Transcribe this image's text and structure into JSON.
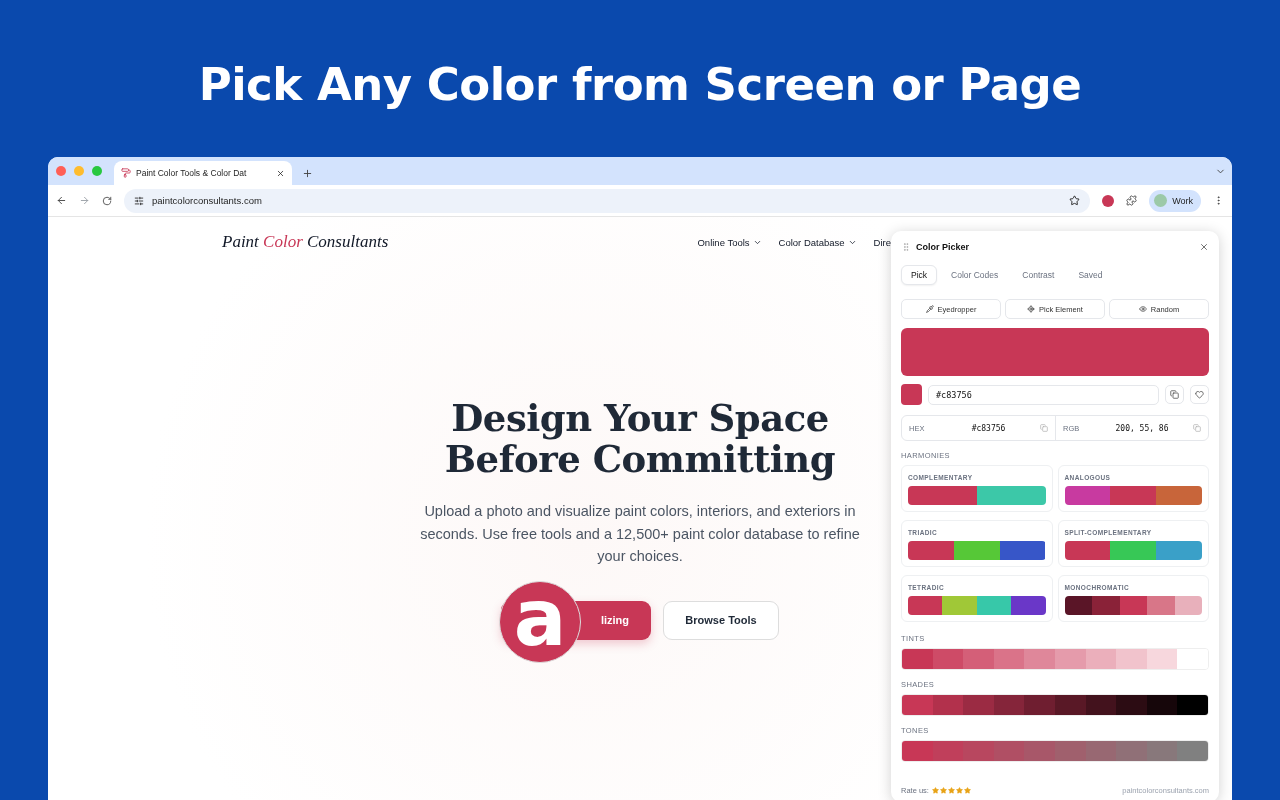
{
  "banner": {
    "title": "Pick Any Color from Screen or Page"
  },
  "browser": {
    "tab": {
      "title": "Paint Color Tools & Color Dat",
      "selected": true
    },
    "address": "paintcolorconsultants.com",
    "profile": "Work"
  },
  "site": {
    "logo": [
      "Paint ",
      "Color",
      " Consultants"
    ],
    "nav": [
      {
        "label": "Online Tools",
        "dropdown": true
      },
      {
        "label": "Color Database",
        "dropdown": true
      },
      {
        "label": "Dire",
        "dropdown": false
      }
    ],
    "hero": {
      "heading_lines": [
        "Design Your Space",
        "Before Committing"
      ],
      "text": "Upload a photo and visualize paint colors, interiors, and exteriors in seconds. Use free tools and a 12,500+ paint color database to refine your choices.",
      "primary_button": "lizing",
      "secondary_button": "Browse Tools",
      "magnifier_glyph": "a"
    }
  },
  "picker": {
    "title": "Color Picker",
    "tabs": [
      {
        "label": "Pick",
        "selected": true
      },
      {
        "label": "Color Codes",
        "selected": false
      },
      {
        "label": "Contrast",
        "selected": false
      },
      {
        "label": "Saved",
        "selected": false
      }
    ],
    "actions": [
      {
        "label": "Eyedropper",
        "kind": "eyedropper"
      },
      {
        "label": "Pick Element",
        "kind": "element"
      },
      {
        "label": "Random",
        "kind": "random"
      }
    ],
    "color": "#c83756",
    "value": "#c83756",
    "codes": [
      {
        "label": "HEX",
        "value": "#c83756"
      },
      {
        "label": "RGB",
        "value": "200, 55, 86"
      }
    ],
    "harmonies_label": "HARMONIES",
    "harmonies": [
      {
        "name": "COMPLEMENTARY",
        "chips": [
          {
            "color": "#c83756"
          },
          {
            "color": "#3cc8a8"
          }
        ]
      },
      {
        "name": "ANALOGOUS",
        "chips": [
          {
            "color": "#c83aa0"
          },
          {
            "color": "#c83756"
          },
          {
            "color": "#c8653a"
          }
        ]
      },
      {
        "name": "TRIADIC",
        "chips": [
          {
            "color": "#c83756"
          },
          {
            "color": "#56c837"
          },
          {
            "color": "#3756c8"
          }
        ]
      },
      {
        "name": "SPLIT-COMPLEMENTARY",
        "chips": [
          {
            "color": "#c83756"
          },
          {
            "color": "#37c856"
          },
          {
            "color": "#3aa0c8"
          }
        ]
      },
      {
        "name": "TETRADIC",
        "chips": [
          {
            "color": "#c83756"
          },
          {
            "color": "#a0c837"
          },
          {
            "color": "#37c8a9"
          },
          {
            "color": "#6a37c8"
          }
        ]
      },
      {
        "name": "MONOCHROMATIC",
        "chips": [
          {
            "color": "#5a1527"
          },
          {
            "color": "#8a2238"
          },
          {
            "color": "#c83756"
          },
          {
            "color": "#d87688"
          },
          {
            "color": "#e8b0bb"
          }
        ]
      }
    ],
    "scales": [
      {
        "name": "TINTS",
        "chips": [
          {
            "color": "#c83756"
          },
          {
            "color": "#ce4b67"
          },
          {
            "color": "#d45f78"
          },
          {
            "color": "#da7389"
          },
          {
            "color": "#df879a"
          },
          {
            "color": "#e59bab"
          },
          {
            "color": "#ebafbb"
          },
          {
            "color": "#f1c3cc"
          },
          {
            "color": "#f7d7dd"
          },
          {
            "color": "#ffffff"
          }
        ]
      },
      {
        "name": "SHADES",
        "chips": [
          {
            "color": "#c83756"
          },
          {
            "color": "#b2314c"
          },
          {
            "color": "#9b2b43"
          },
          {
            "color": "#85253a"
          },
          {
            "color": "#6f1e30"
          },
          {
            "color": "#591826"
          },
          {
            "color": "#43121d"
          },
          {
            "color": "#2c0c13"
          },
          {
            "color": "#16060a"
          },
          {
            "color": "#000000"
          }
        ]
      },
      {
        "name": "TONES",
        "chips": [
          {
            "color": "#c83756"
          },
          {
            "color": "#c03f5b"
          },
          {
            "color": "#b8475f"
          },
          {
            "color": "#b04f64"
          },
          {
            "color": "#a85769"
          },
          {
            "color": "#a0606d"
          },
          {
            "color": "#986872"
          },
          {
            "color": "#907077"
          },
          {
            "color": "#88787b"
          },
          {
            "color": "#808080"
          }
        ]
      }
    ],
    "rate_label": "Rate us:",
    "stars": 5,
    "footer_link": "paintcolorconsultants.com"
  }
}
